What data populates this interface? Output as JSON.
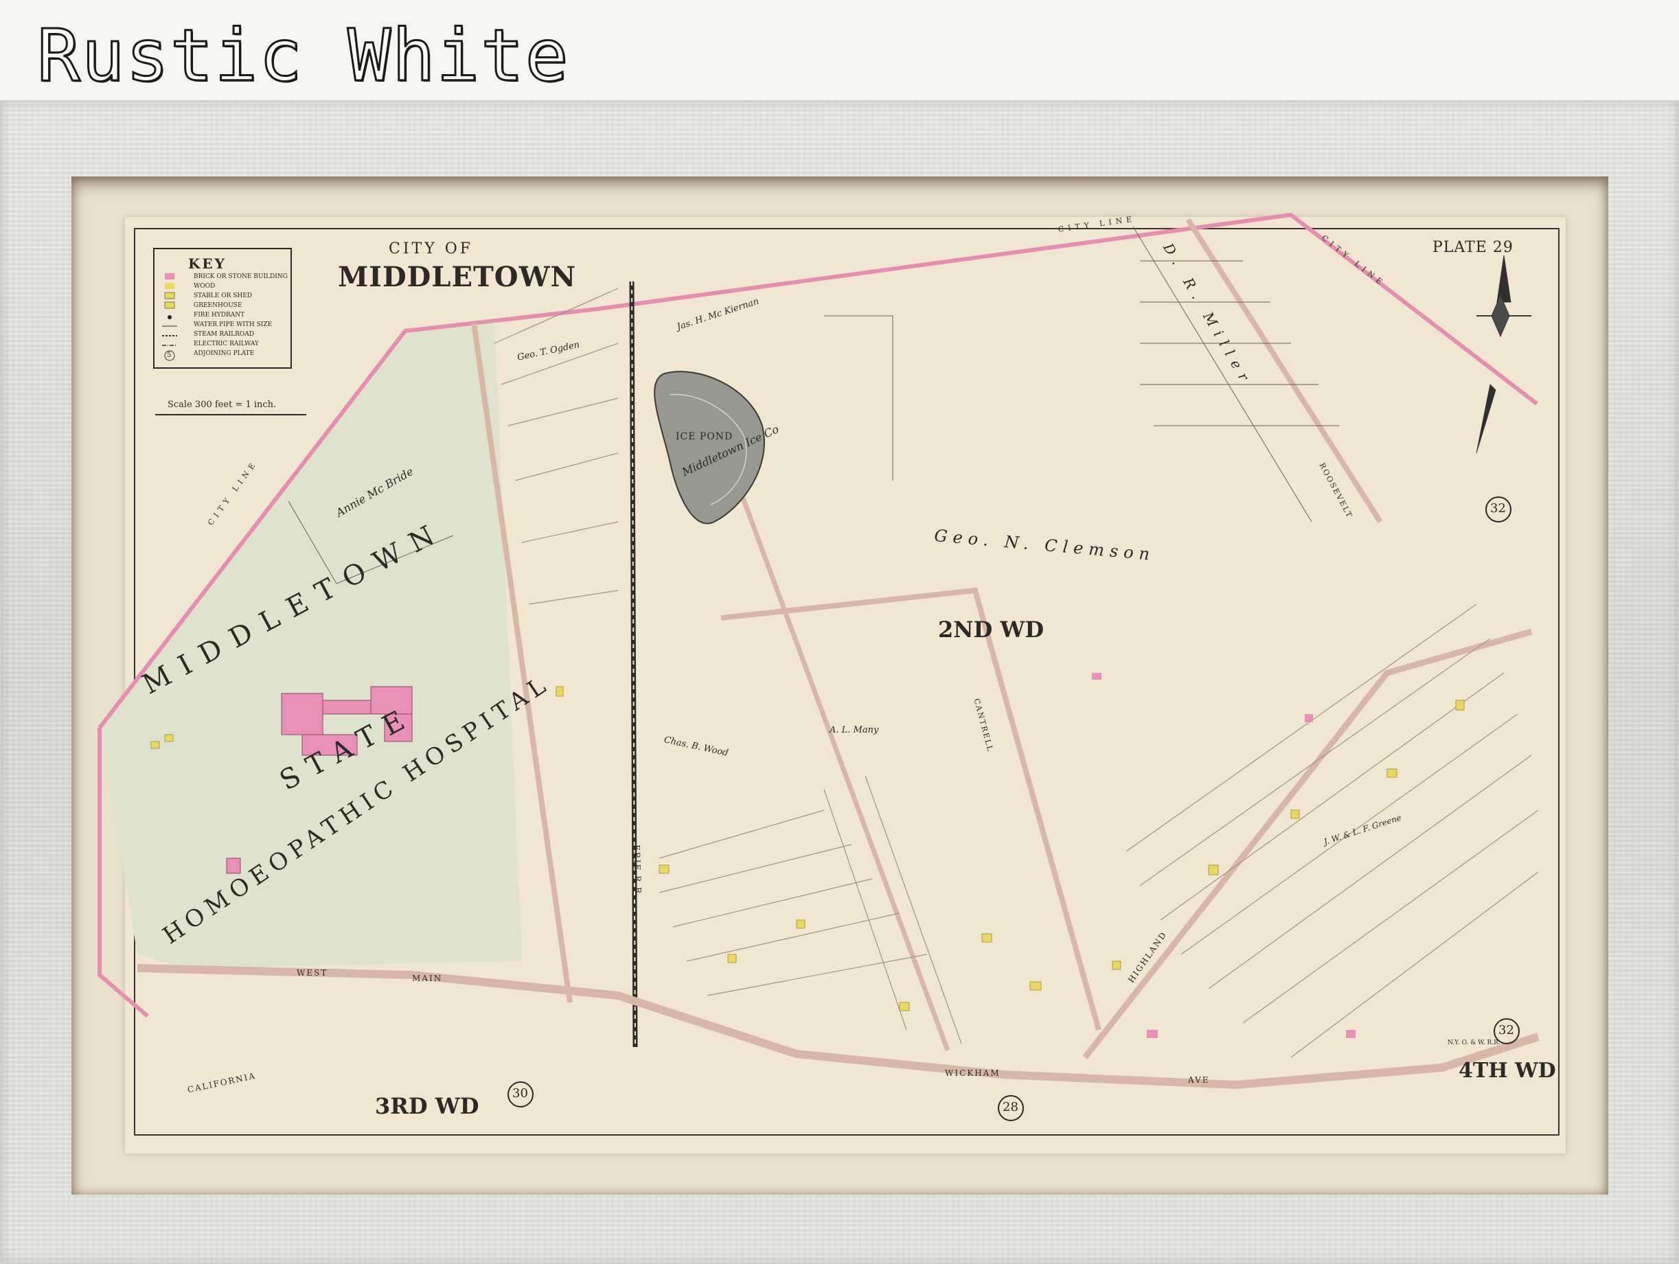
{
  "frame": {
    "title": "Rustic White",
    "colors": {
      "frame": "#e2e2de",
      "mat": "#eae1cc",
      "paper": "#f1e6d2"
    }
  },
  "map": {
    "plate": "PLATE 29",
    "city_of": "CITY OF",
    "city_name": "MIDDLETOWN",
    "key": {
      "title": "KEY",
      "items": [
        "BRICK OR STONE BUILDING",
        "WOOD",
        "STABLE OR SHED",
        "GREENHOUSE",
        "FIRE HYDRANT",
        "WATER PIPE WITH SIZE",
        "STEAM RAILROAD",
        "ELECTRIC RAILWAY",
        "ADJOINING PLATE"
      ],
      "key_number": "5"
    },
    "scale": "Scale 300 feet = 1 inch.",
    "wards": {
      "second": "2ND WD",
      "third": "3RD WD",
      "fourth": "4TH WD"
    },
    "adjoining_plates": [
      "32",
      "32",
      "30",
      "28"
    ],
    "hospital": {
      "line1": "MIDDLETOWN",
      "line2": "STATE",
      "line3": "HOMOEOPATHIC HOSPITAL"
    },
    "water": {
      "ice_pond": "ICE POND"
    },
    "owners": [
      "Geo. N. Clemson",
      "D. R. Miller",
      "Annie Mc Bride",
      "Middletown Ice Co",
      "Jas. H. Mc Kiernan",
      "Geo. T. Ogden",
      "A. L. Many",
      "Chas. B. Wood",
      "J. W. & L. F. Greene"
    ],
    "streets": [
      "WEST",
      "MAIN",
      "AVE",
      "CALIFORNIA",
      "WICKHAM",
      "HIGHLAND",
      "CANTRELL",
      "ROOSEVELT",
      "ERIE R.R.",
      "N.Y. O. & W. R.R."
    ],
    "line_label": "CITY LINE",
    "colors": {
      "city_line": "#e58fb0",
      "hospital": "#dfe2cd",
      "brick": "#e890b7",
      "wood": "#e9d964"
    }
  }
}
